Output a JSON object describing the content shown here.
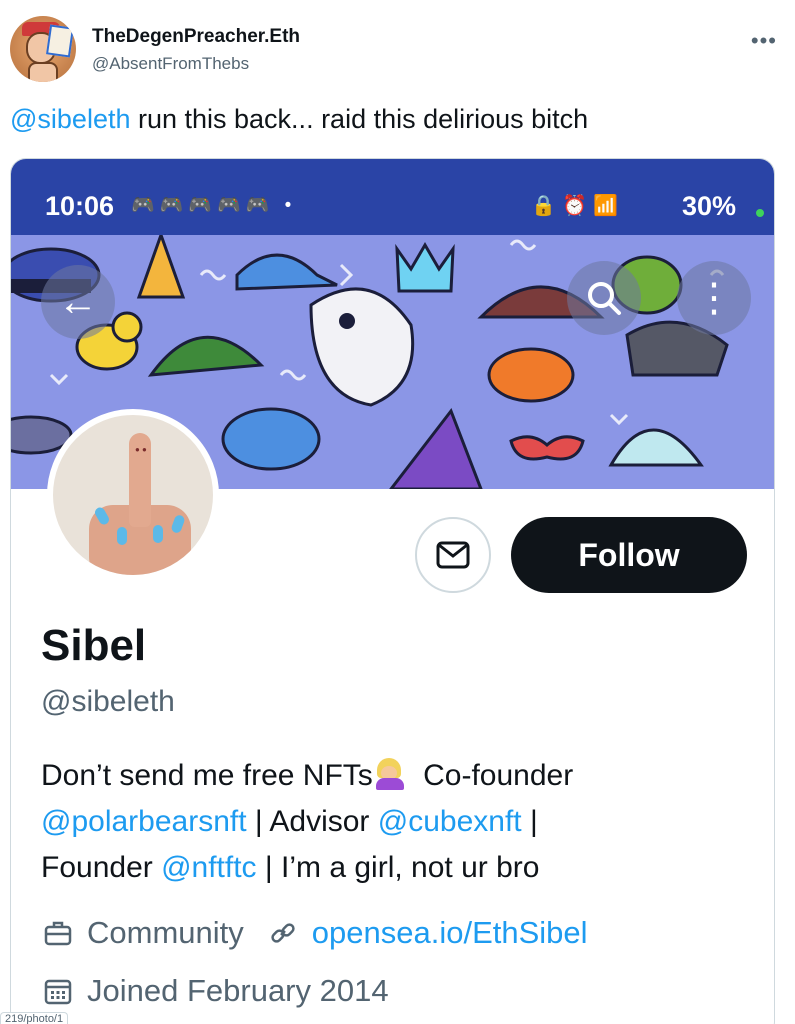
{
  "tweet": {
    "author_name": "TheDegenPreacher.Eth",
    "author_handle": "@AbsentFromThebs",
    "more_icon": "more-horizontal-icon",
    "text_mention": "@sibeleth",
    "text_rest": " run this back... raid this delirious bitch"
  },
  "screenshot": {
    "status_time": "10:06",
    "status_battery": "30%",
    "banner_colors": {
      "background": "#8b96e6"
    },
    "profile": {
      "display_name": "Sibel",
      "handle": "@sibeleth",
      "follow_label": "Follow",
      "bio": {
        "part1": "Don’t send me free NFTs",
        "part2": " Co-founder",
        "link1": "@polarbearsnft",
        "part3": " | Advisor ",
        "link2": "@cubexnft",
        "part4": " |",
        "part5": "Founder ",
        "link3": "@nftftc",
        "part6": " | I’m a girl, not ur bro"
      },
      "category": "Community",
      "website": "opensea.io/EthSibel",
      "joined": "Joined February 2014"
    }
  },
  "footer": {
    "partial_url": "219/photo/1"
  },
  "colors": {
    "link": "#1d9bf0",
    "text": "#0f1419",
    "secondary": "#536471",
    "statusbar": "#2a44a6",
    "follow_bg": "#0f1419"
  }
}
